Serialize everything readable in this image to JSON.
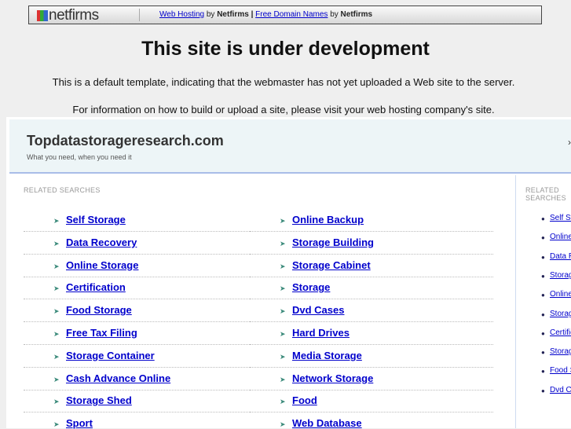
{
  "banner": {
    "logo": "netfirms",
    "link1": "Web Hosting",
    "by1": "by",
    "brand1": "Netfirms",
    "pipe": "|",
    "link2": "Free Domain Names",
    "by2": "by",
    "brand2": "Netfirms"
  },
  "title": "This site is under development",
  "line1": "This is a default template, indicating that the webmaster has not yet uploaded a Web site to the server.",
  "line2": "For information on how to build or upload a site, please visit your web hosting company's site.",
  "site": {
    "name": "Topdatastorageresearch.com",
    "tagline": "What you need, when you need it",
    "header_arrow": "›"
  },
  "left": {
    "heading": "RELATED SEARCHES",
    "col1": [
      "Self Storage",
      "Data Recovery",
      "Online Storage",
      "Certification",
      "Food Storage",
      "Free Tax Filing",
      "Storage Container",
      "Cash Advance Online",
      "Storage Shed",
      "Sport"
    ],
    "col2": [
      "Online Backup",
      "Storage Building",
      "Storage Cabinet",
      "Storage",
      "Dvd Cases",
      "Hard Drives",
      "Media Storage",
      "Network Storage",
      "Food",
      "Web Database"
    ]
  },
  "right": {
    "heading": "RELATED SEARCHES",
    "items": [
      "Self Storage",
      "Online Backup",
      "Data Recovery",
      "Storage Building",
      "Online Storage",
      "Storage Cabinet",
      "Certification",
      "Storage",
      "Food Storage",
      "Dvd Cases"
    ]
  }
}
